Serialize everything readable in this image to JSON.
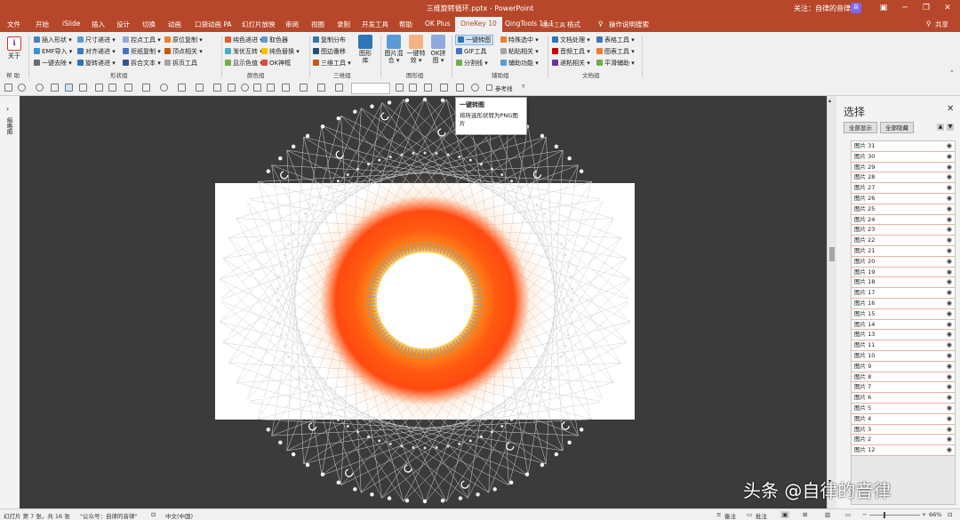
{
  "titlebar": {
    "title": "三维旋转循环.pptx  -  PowerPoint",
    "follow": "关注：自律的音律",
    "avatar": "自"
  },
  "tabs": [
    "文件",
    "开始",
    "iSlide",
    "插入",
    "设计",
    "切换",
    "动画",
    "口袋动画 PA",
    "幻灯片放映",
    "审阅",
    "视图",
    "录制",
    "开发工具",
    "帮助",
    "OK Plus",
    "OneKey 10",
    "QingTools 13.1",
    "格式",
    "操作说明搜索"
  ],
  "active_tab": "OneKey 10",
  "context_label": "图片工具",
  "share": "共享",
  "ribbon": {
    "help_group": {
      "button": "关于",
      "label": "帮 助"
    },
    "shape_group": {
      "items": [
        "插入形状 ▾",
        "EMF导入 ▾",
        "一键去除 ▾",
        "尺寸递进 ▾",
        "对齐递进 ▾",
        "旋转递进 ▾",
        "控点工具 ▾",
        "拒纸复制 ▾",
        "拆合文本 ▾",
        "原位复制 ▾",
        "顶点相关 ▾",
        "拆页工具"
      ],
      "label": "形状组"
    },
    "color_group": {
      "items": [
        "纯色递进 ▾",
        "渐优互转 ▾",
        "显示色值 ▾",
        "取色器",
        "纯色替换 ▾",
        "OK神框"
      ],
      "label": "颜色组"
    },
    "threed_group": {
      "items": [
        "复制分布",
        "图边番移",
        "三维工具 ▾"
      ],
      "big": "图形库",
      "label": "三维组"
    },
    "image_group": {
      "big": [
        "图片混合 ▾",
        "一键特效 ▾",
        "OK拼图 ▾"
      ],
      "label": "图形组"
    },
    "assist_group": {
      "items": [
        "一键转图",
        "GIF工具",
        "分割线 ▾",
        "特殊选中 ▾",
        "粘贴相关 ▾",
        "辅助功能 ▾"
      ],
      "label": "辅助组"
    },
    "doc_group": {
      "items": [
        "文档处理 ▾",
        "音频工具 ▾",
        "递粘相关 ▾",
        "表格工具 ▾",
        "图表工具 ▾",
        "平滑辅助 ▾"
      ],
      "label": "文档组"
    }
  },
  "qat": {
    "reference_line": "参考线"
  },
  "leftpane": {
    "label": "缩略图"
  },
  "tooltip": {
    "title": "一键转图",
    "desc": "将所选形状转为PNG图片"
  },
  "selection_pane": {
    "title": "选择",
    "show_all": "全部显示",
    "hide_all": "全部隐藏",
    "items": [
      "图片 31",
      "图片 30",
      "图片 29",
      "图片 28",
      "图片 27",
      "图片 26",
      "图片 25",
      "图片 24",
      "图片 23",
      "图片 22",
      "图片 21",
      "图片 20",
      "图片 19",
      "图片 18",
      "图片 17",
      "图片 16",
      "图片 15",
      "图片 14",
      "图片 13",
      "图片 11",
      "图片 10",
      "图片 9",
      "图片 8",
      "图片 7",
      "图片 6",
      "图片 5",
      "图片 4",
      "图片 3",
      "图片 2",
      "图片 12"
    ]
  },
  "statusbar": {
    "slide": "幻灯片 第 7 张，共 16 张",
    "public": "\"公众号：自律的音律\"",
    "lang": "中文(中国)",
    "notes": "备注",
    "comments": "批注",
    "zoom": "66%"
  },
  "watermark": "头条 @自律的音律",
  "colors": {
    "accent": "#b7472a",
    "ring_orange": "#ff5a10",
    "pane_border": "#e8b4a5"
  }
}
